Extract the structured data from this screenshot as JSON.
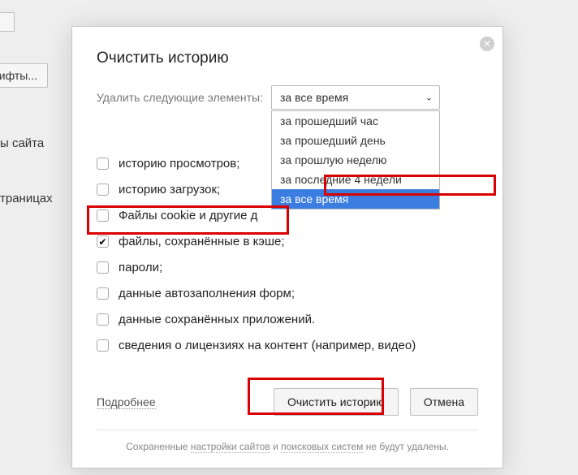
{
  "bg": {
    "truncated_button": "рифты...",
    "label_site": "ы сайта",
    "label_pages": "траницах"
  },
  "dialog": {
    "title": "Очистить историю",
    "period_label": "Удалить следующие элементы:",
    "selected_period": "за все время",
    "options": [
      "за прошедший час",
      "за прошедший день",
      "за прошлую неделю",
      "за последние 4 недели",
      "за все время"
    ],
    "checks": [
      {
        "label": "историю просмотров;",
        "checked": false
      },
      {
        "label": "историю загрузок;",
        "checked": false
      },
      {
        "label": "Файлы cookie и другие д",
        "checked": false
      },
      {
        "label": "файлы, сохранённые в кэше;",
        "checked": true
      },
      {
        "label": "пароли;",
        "checked": false
      },
      {
        "label": "данные автозаполнения форм;",
        "checked": false
      },
      {
        "label": "данные сохранённых приложений.",
        "checked": false
      },
      {
        "label": "сведения о лицензиях на контент (например, видео)",
        "checked": false
      }
    ],
    "more": "Подробнее",
    "clear_btn": "Очистить историю",
    "cancel_btn": "Отмена",
    "footnote_prefix": "Сохраненные ",
    "footnote_link1": "настройки сайтов",
    "footnote_mid": " и ",
    "footnote_link2": "поисковых систем",
    "footnote_suffix": " не будут удалены."
  }
}
